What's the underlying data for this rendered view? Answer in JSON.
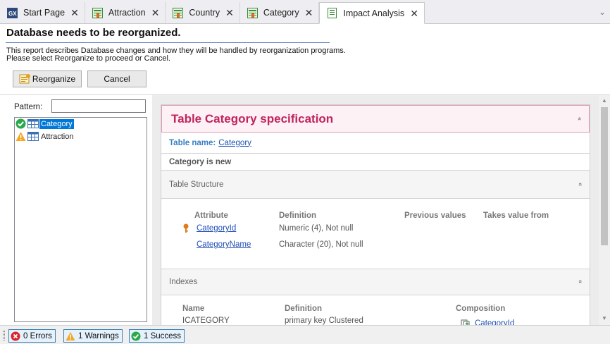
{
  "tabs": [
    {
      "label": "Start Page",
      "icon": "gx-logo-icon",
      "close": "✕",
      "active": false
    },
    {
      "label": "Attraction",
      "icon": "transaction-icon",
      "close": "✕",
      "active": false
    },
    {
      "label": "Country",
      "icon": "transaction-icon",
      "close": "✕",
      "active": false
    },
    {
      "label": "Category",
      "icon": "transaction-icon",
      "close": "✕",
      "active": false
    },
    {
      "label": "Impact Analysis",
      "icon": "report-icon",
      "close": "✕",
      "active": true
    }
  ],
  "header": {
    "title": "Database needs to be reorganized.",
    "desc_line1": "This report describes Database changes and how they will be handled by reorganization programs.",
    "desc_line2": "Please select Reorganize to proceed or Cancel.",
    "reorganize_label": "Reorganize",
    "cancel_label": "Cancel"
  },
  "left": {
    "pattern_label": "Pattern:",
    "pattern_value": "",
    "tree": [
      {
        "label": "Category",
        "status": "success",
        "selected": true
      },
      {
        "label": "Attraction",
        "status": "warning",
        "selected": false
      }
    ]
  },
  "spec": {
    "title": "Table Category specification",
    "table_name_label": "Table name:",
    "table_name": "Category",
    "new_note": "Category is new",
    "structure_title": "Table Structure",
    "structure_headers": {
      "attribute": "Attribute",
      "definition": "Definition",
      "previous": "Previous values",
      "takes": "Takes value from"
    },
    "attributes": [
      {
        "name": "CategoryId",
        "definition": "Numeric (4), Not null",
        "key": true
      },
      {
        "name": "CategoryName",
        "definition": "Character (20), Not null",
        "key": false
      }
    ],
    "indexes_title": "Indexes",
    "index_headers": {
      "name": "Name",
      "definition": "Definition",
      "composition": "Composition"
    },
    "indexes": [
      {
        "name": "ICATEGORY",
        "definition": "primary key Clustered",
        "composition": "CategoryId"
      }
    ],
    "collapse_glyph": "»"
  },
  "status": {
    "errors": "0 Errors",
    "warnings": "1 Warnings",
    "success": "1 Success"
  },
  "colors": {
    "accent": "#c0245c",
    "link": "#1f4fb5",
    "success": "#2aa84a",
    "warning": "#f5a623",
    "error": "#d9232d"
  }
}
